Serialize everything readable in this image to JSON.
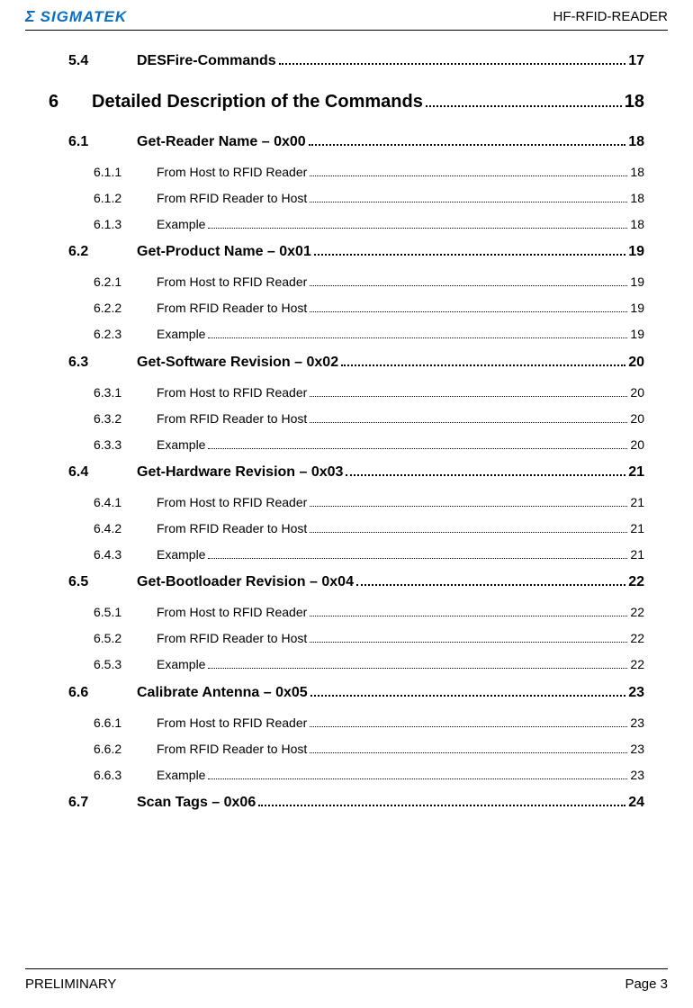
{
  "header": {
    "logo_mark": "Σ",
    "logo_text": "SIGMATEK",
    "doc_id": "HF-RFID-READER"
  },
  "footer": {
    "left": "PRELIMINARY",
    "right": "Page 3"
  },
  "toc": {
    "pre": {
      "num": "5.4",
      "title": "DESFire-Commands",
      "page": "17"
    },
    "chapter": {
      "num": "6",
      "title": "Detailed Description of the Commands",
      "page": "18"
    },
    "sections": [
      {
        "num": "6.1",
        "title": "Get-Reader Name – 0x00",
        "page": "18",
        "subs": [
          {
            "num": "6.1.1",
            "title": "From Host to RFID Reader",
            "page": "18"
          },
          {
            "num": "6.1.2",
            "title": "From RFID Reader to Host",
            "page": "18"
          },
          {
            "num": "6.1.3",
            "title": "Example",
            "page": "18"
          }
        ]
      },
      {
        "num": "6.2",
        "title": "Get-Product Name – 0x01",
        "page": "19",
        "subs": [
          {
            "num": "6.2.1",
            "title": "From Host to RFID Reader",
            "page": "19"
          },
          {
            "num": "6.2.2",
            "title": "From RFID Reader to Host",
            "page": "19"
          },
          {
            "num": "6.2.3",
            "title": "Example",
            "page": "19"
          }
        ]
      },
      {
        "num": "6.3",
        "title": "Get-Software Revision – 0x02",
        "page": "20",
        "subs": [
          {
            "num": "6.3.1",
            "title": "From Host to RFID Reader",
            "page": "20"
          },
          {
            "num": "6.3.2",
            "title": "From RFID Reader to Host",
            "page": "20"
          },
          {
            "num": "6.3.3",
            "title": "Example",
            "page": "20"
          }
        ]
      },
      {
        "num": "6.4",
        "title": "Get-Hardware Revision – 0x03",
        "page": "21",
        "subs": [
          {
            "num": "6.4.1",
            "title": "From Host to RFID Reader",
            "page": "21"
          },
          {
            "num": "6.4.2",
            "title": "From RFID Reader to Host",
            "page": "21"
          },
          {
            "num": "6.4.3",
            "title": "Example",
            "page": "21"
          }
        ]
      },
      {
        "num": "6.5",
        "title": "Get-Bootloader Revision – 0x04",
        "page": "22",
        "subs": [
          {
            "num": "6.5.1",
            "title": "From Host to RFID Reader",
            "page": "22"
          },
          {
            "num": "6.5.2",
            "title": "From RFID Reader to Host",
            "page": "22"
          },
          {
            "num": "6.5.3",
            "title": "Example",
            "page": "22"
          }
        ]
      },
      {
        "num": "6.6",
        "title": "Calibrate Antenna – 0x05",
        "page": "23",
        "subs": [
          {
            "num": "6.6.1",
            "title": "From Host to RFID Reader",
            "page": "23"
          },
          {
            "num": "6.6.2",
            "title": "From RFID Reader to Host",
            "page": "23"
          },
          {
            "num": "6.6.3",
            "title": "Example",
            "page": "23"
          }
        ]
      },
      {
        "num": "6.7",
        "title": "Scan Tags – 0x06",
        "page": "24",
        "subs": []
      }
    ]
  }
}
